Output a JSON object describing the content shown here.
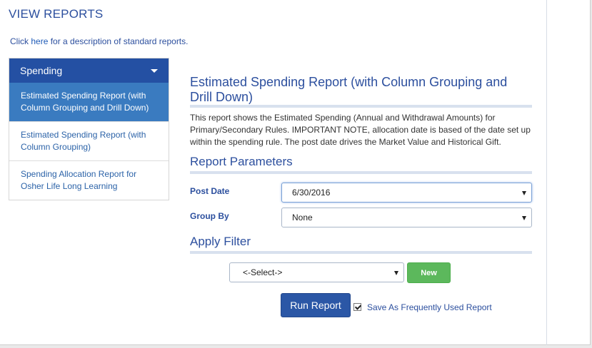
{
  "page": {
    "title": "VIEW REPORTS",
    "click_prefix": "Click ",
    "click_link": "here",
    "click_suffix": " for a description of standard reports."
  },
  "sidebar": {
    "header": "Spending",
    "items": [
      {
        "label": "Estimated Spending Report (with Column Grouping and Drill Down)",
        "active": true
      },
      {
        "label": "Estimated Spending Report (with Column Grouping)",
        "active": false
      },
      {
        "label": "Spending Allocation Report for Osher Life Long Learning",
        "active": false
      }
    ]
  },
  "report": {
    "title": "Estimated Spending Report (with Column Grouping and Drill Down)",
    "description": "This report shows the Estimated Spending (Annual and Withdrawal Amounts) for Primary/Secondary Rules. IMPORTANT NOTE, allocation date is based of the date set up within the spending rule. The post date drives the Market Value and Historical Gift."
  },
  "parameters": {
    "heading": "Report Parameters",
    "post_date_label": "Post Date",
    "post_date_value": "6/30/2016",
    "group_by_label": "Group By",
    "group_by_value": "None"
  },
  "filter": {
    "heading": "Apply Filter",
    "select_value": "<-Select->",
    "new_label": "New"
  },
  "actions": {
    "run_label": "Run Report",
    "save_frequent_label": "Save As Frequently Used Report",
    "save_frequent_checked": true
  },
  "colors": {
    "brand_blue": "#2450a3",
    "active_item": "#3a7bc0",
    "new_button": "#5cb85c"
  }
}
